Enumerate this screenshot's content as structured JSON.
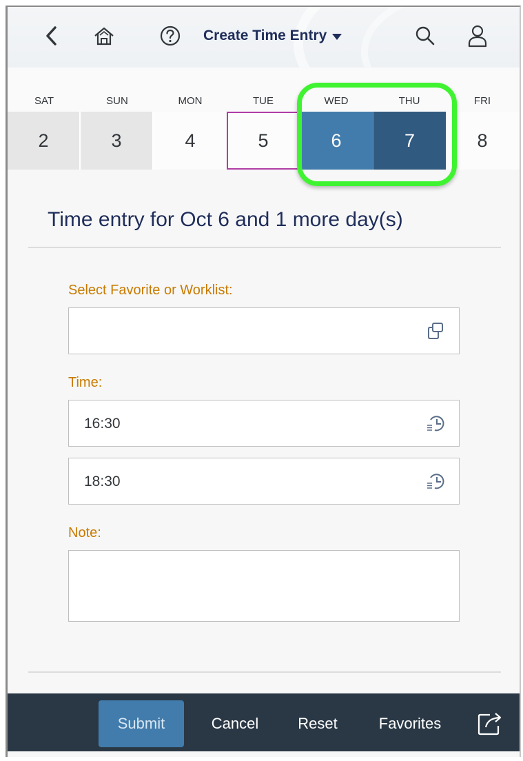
{
  "header": {
    "title": "Create Time Entry",
    "icons": [
      "back-icon",
      "home-icon",
      "help-icon",
      "dropdown-icon",
      "search-icon",
      "user-icon"
    ]
  },
  "calendar": {
    "days": [
      {
        "name": "SAT",
        "num": "2",
        "state": "weekend"
      },
      {
        "name": "SUN",
        "num": "3",
        "state": "weekend"
      },
      {
        "name": "MON",
        "num": "4",
        "state": "normal"
      },
      {
        "name": "TUE",
        "num": "5",
        "state": "today"
      },
      {
        "name": "WED",
        "num": "6",
        "state": "selected"
      },
      {
        "name": "THU",
        "num": "7",
        "state": "selected"
      },
      {
        "name": "FRI",
        "num": "8",
        "state": "normal"
      }
    ]
  },
  "form": {
    "title": "Time entry for Oct 6 and 1 more day(s)",
    "favorite_label": "Select Favorite or Worklist:",
    "favorite_value": "",
    "time_label": "Time:",
    "start_time": "16:30",
    "end_time": "18:30",
    "note_label": "Note:",
    "note_value": ""
  },
  "footer": {
    "submit": "Submit",
    "cancel": "Cancel",
    "reset": "Reset",
    "favorites": "Favorites",
    "share_icon": "share-icon"
  },
  "colors": {
    "accent": "#427cac",
    "selected_dark": "#305a80",
    "label": "#c87b00",
    "highlight": "#3ff331",
    "footer": "#2a3845"
  }
}
